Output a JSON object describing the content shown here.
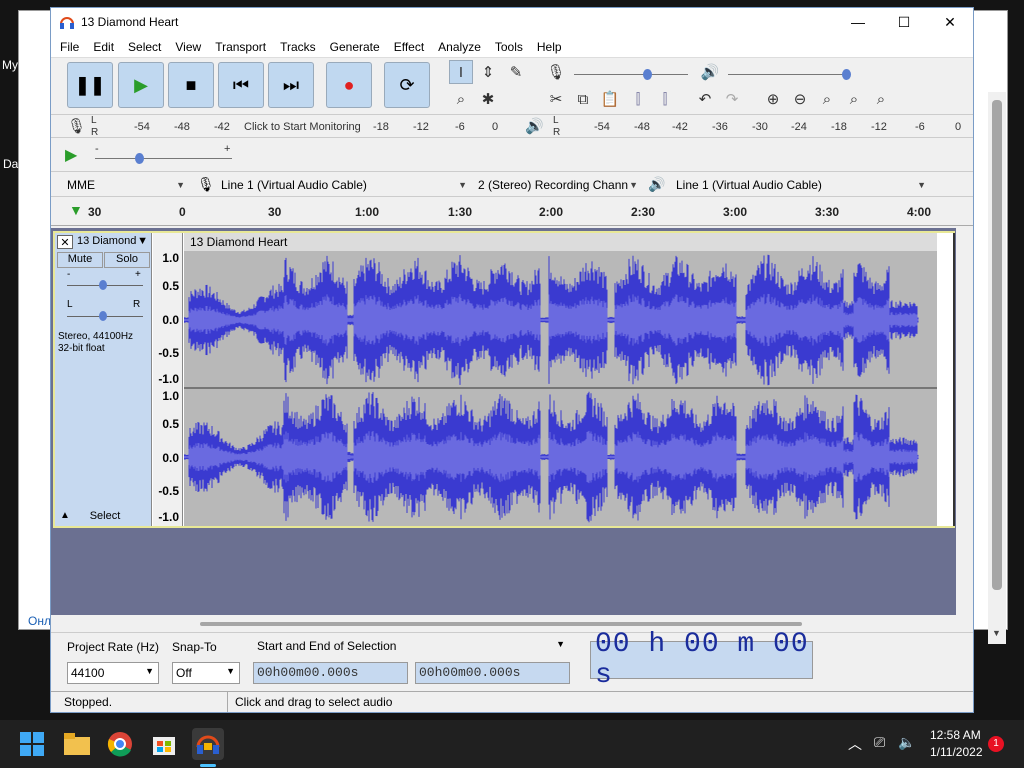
{
  "window": {
    "title": "13 Diamond Heart",
    "minimize": "—",
    "maximize": "☐",
    "close": "✕"
  },
  "menu": [
    "File",
    "Edit",
    "Select",
    "View",
    "Transport",
    "Tracks",
    "Generate",
    "Effect",
    "Analyze",
    "Tools",
    "Help"
  ],
  "meters": {
    "record_ticks": [
      "-54",
      "-48",
      "-42",
      "-18",
      "-12",
      "-6",
      "0"
    ],
    "monitor_text": "Click to Start Monitoring",
    "play_ticks": [
      "-54",
      "-48",
      "-42",
      "-36",
      "-30",
      "-24",
      "-18",
      "-12",
      "-6",
      "0"
    ],
    "lr": [
      "L",
      "R"
    ]
  },
  "devices": {
    "host": "MME",
    "input": "Line 1 (Virtual Audio Cable)",
    "channels": "2 (Stereo) Recording Chann",
    "output": "Line 1 (Virtual Audio Cable)"
  },
  "ruler": {
    "ticks": [
      "30",
      "0",
      "30",
      "1:00",
      "1:30",
      "2:00",
      "2:30",
      "3:00",
      "3:30",
      "4:00"
    ]
  },
  "track": {
    "name_short": "13 Diamond",
    "name": "13 Diamond Heart",
    "mute": "Mute",
    "solo": "Solo",
    "gain_minus": "-",
    "gain_plus": "+",
    "pan_l": "L",
    "pan_r": "R",
    "info1": "Stereo, 44100Hz",
    "info2": "32-bit float",
    "select": "Select",
    "scale": [
      "1.0",
      "0.5",
      "0.0",
      "-0.5",
      "-1.0"
    ]
  },
  "selection": {
    "rate_label": "Project Rate (Hz)",
    "rate": "44100",
    "snap_label": "Snap-To",
    "snap": "Off",
    "mode": "Start and End of Selection",
    "start": "00h00m00.000s",
    "end": "00h00m00.000s",
    "time": "00 h 00 m 00 s"
  },
  "status": {
    "left": "Stopped.",
    "right": "Click and drag to select audio"
  },
  "taskbar": {
    "time": "12:58 AM",
    "date": "1/11/2022",
    "badge": "1"
  },
  "background": {
    "t1": "My",
    "t2": "Da",
    "t3": "Онл"
  },
  "colors": {
    "wave": "#3a3ad0",
    "wave_inner": "#6a6ae0",
    "accent": "#1a2c9c"
  }
}
